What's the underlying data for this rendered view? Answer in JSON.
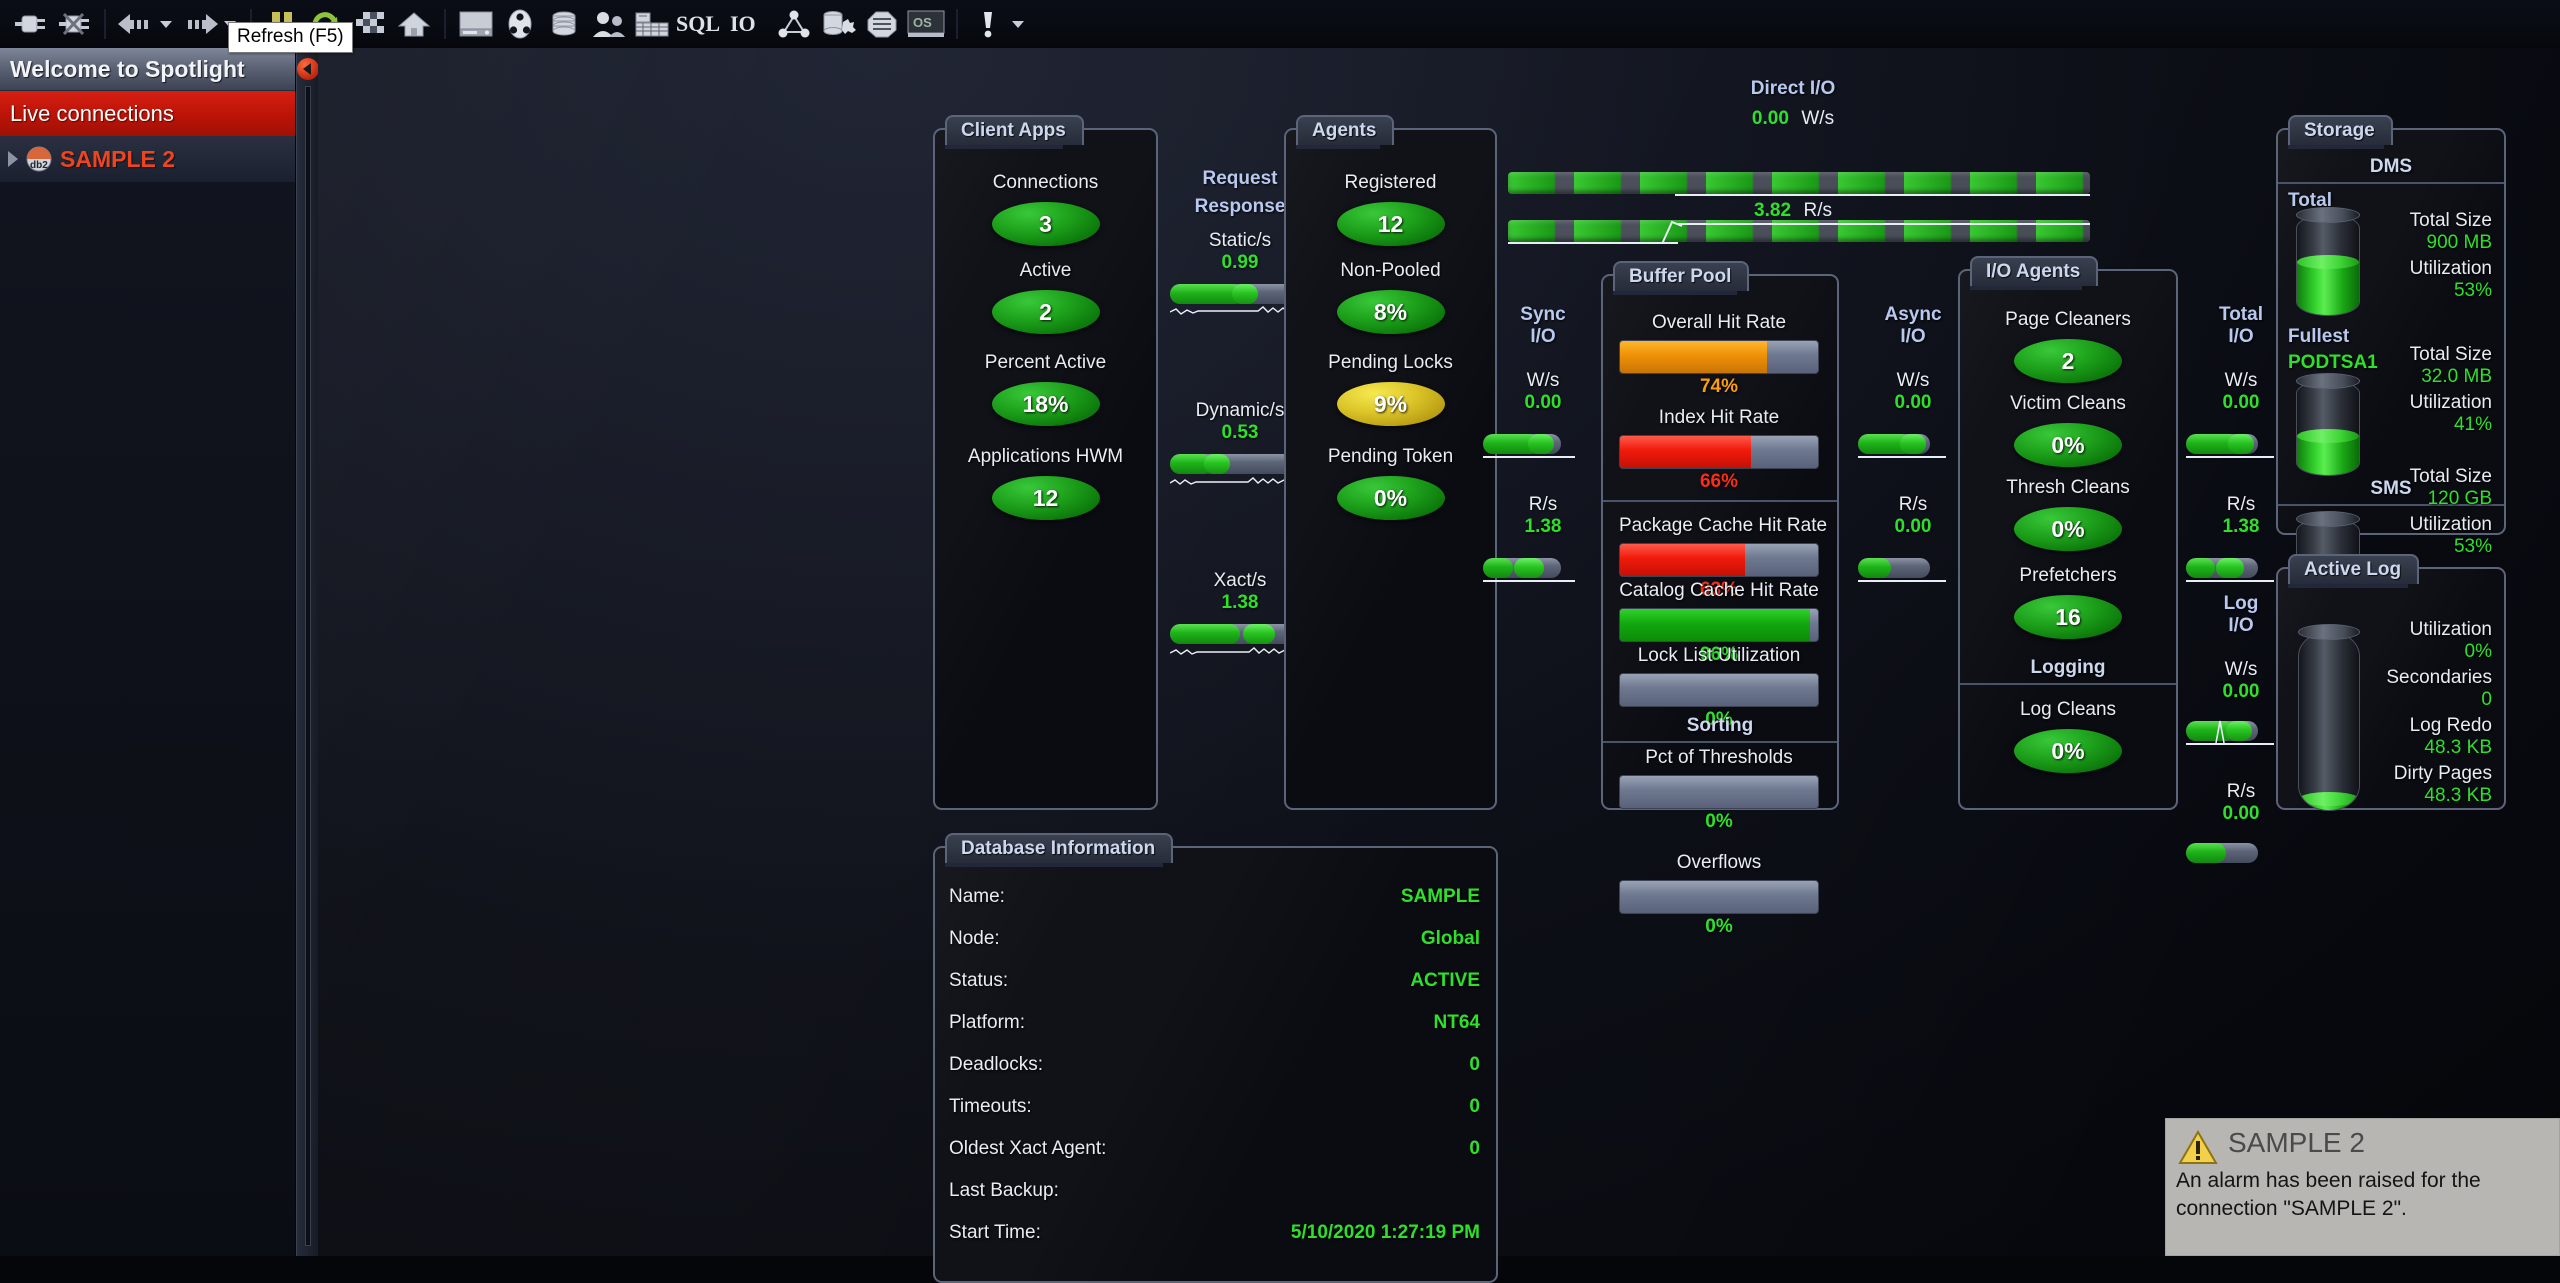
{
  "app": {
    "tooltip": "Refresh (F5)"
  },
  "toolbar": {
    "buttons": [
      {
        "name": "connect-icon",
        "label": "Connect"
      },
      {
        "name": "disconnect-icon",
        "label": "Disconnect"
      },
      {
        "name": "back-icon",
        "label": "Back"
      },
      {
        "name": "back-dropdown-icon",
        "label": "Back history"
      },
      {
        "name": "forward-icon",
        "label": "Forward"
      },
      {
        "name": "forward-dropdown-icon",
        "label": "Forward history"
      },
      {
        "name": "pause-icon",
        "label": "Pause"
      },
      {
        "name": "refresh-icon",
        "label": "Refresh (F5)"
      },
      {
        "name": "playback-icon",
        "label": "Playback"
      },
      {
        "name": "home-icon",
        "label": "Home"
      },
      {
        "name": "server-icon",
        "label": "Server"
      },
      {
        "name": "sessions-icon",
        "label": "Sessions"
      },
      {
        "name": "database-icon",
        "label": "Databases"
      },
      {
        "name": "users-icon",
        "label": "Users"
      },
      {
        "name": "buildings-icon",
        "label": "Tablespaces"
      },
      {
        "name": "sql-icon",
        "label": "SQL"
      },
      {
        "name": "io-icon",
        "label": "IO"
      },
      {
        "name": "topology-icon",
        "label": "Topology"
      },
      {
        "name": "storage-tool-icon",
        "label": "Storage"
      },
      {
        "name": "logs-icon",
        "label": "Logs"
      },
      {
        "name": "os-icon",
        "label": "OS"
      },
      {
        "name": "alarm-icon",
        "label": "Alarms"
      },
      {
        "name": "alarm-dropdown-icon",
        "label": "Alarm options"
      }
    ]
  },
  "sidebar": {
    "title": "Welcome to Spotlight",
    "live_connections_label": "Live connections",
    "connections": [
      {
        "label": "SAMPLE 2",
        "icon": "db2-connection-icon"
      }
    ]
  },
  "client_apps": {
    "title": "Client Apps",
    "metrics": [
      {
        "caption": "Connections",
        "value": "3",
        "color": "green"
      },
      {
        "caption": "Active",
        "value": "2",
        "color": "green"
      },
      {
        "caption": "Percent Active",
        "value": "18%",
        "color": "green"
      },
      {
        "caption": "Applications HWM",
        "value": "12",
        "color": "green"
      }
    ]
  },
  "request_response": {
    "line1": "Request",
    "line2": "Response",
    "gauges": [
      {
        "caption": "Static/s",
        "value": "0.99",
        "fill_pct": 52
      },
      {
        "caption": "Dynamic/s",
        "value": "0.53",
        "fill_pct": 30
      },
      {
        "caption": "Xact/s",
        "value": "1.38",
        "fill_pct": 72
      }
    ]
  },
  "agents": {
    "title": "Agents",
    "metrics": [
      {
        "caption": "Registered",
        "value": "12",
        "color": "green"
      },
      {
        "caption": "Non-Pooled",
        "value": "8%",
        "color": "green"
      },
      {
        "caption": "Pending Locks",
        "value": "9%",
        "color": "yellow"
      },
      {
        "caption": "Pending Token",
        "value": "0%",
        "color": "green"
      }
    ]
  },
  "direct_io": {
    "title": "Direct I/O",
    "write_value": "0.00",
    "write_unit": "W/s",
    "read_value": "3.82",
    "read_unit": "R/s"
  },
  "sync_io": {
    "title_line1": "Sync",
    "title_line2": "I/O",
    "write_unit": "W/s",
    "write_value": "0.00",
    "read_unit": "R/s",
    "read_value": "1.38"
  },
  "async_io": {
    "title_line1": "Async",
    "title_line2": "I/O",
    "write_unit": "W/s",
    "write_value": "0.00",
    "read_unit": "R/s",
    "read_value": "0.00"
  },
  "total_io": {
    "title_line1": "Total",
    "title_line2": "I/O",
    "write_unit": "W/s",
    "write_value": "0.00",
    "read_unit": "R/s",
    "read_value": "1.38"
  },
  "log_io": {
    "title_line1": "Log",
    "title_line2": "I/O",
    "write_unit": "W/s",
    "write_value": "0.00",
    "read_unit": "R/s",
    "read_value": "0.00"
  },
  "buffer_pool": {
    "title": "Buffer Pool",
    "sorting_header": "Sorting",
    "bars": [
      {
        "caption": "Overall Hit Rate",
        "value": "74%",
        "pct": 74,
        "color": "orange"
      },
      {
        "caption": "Index Hit Rate",
        "value": "66%",
        "pct": 66,
        "color": "red"
      },
      {
        "caption": "Package Cache Hit Rate",
        "value": "63%",
        "pct": 63,
        "color": "red"
      },
      {
        "caption": "Catalog Cache Hit Rate",
        "value": "96%",
        "pct": 96,
        "color": "green"
      },
      {
        "caption": "Lock List Utilization",
        "value": "0%",
        "pct": 0,
        "color": "empty"
      }
    ],
    "sorting_bars": [
      {
        "caption": "Pct of Thresholds",
        "value": "0%",
        "pct": 0,
        "color": "empty"
      },
      {
        "caption": "Overflows",
        "value": "0%",
        "pct": 0,
        "color": "empty"
      }
    ]
  },
  "io_agents": {
    "title": "I/O Agents",
    "logging_header": "Logging",
    "metrics": [
      {
        "caption": "Page Cleaners",
        "value": "2",
        "color": "green"
      },
      {
        "caption": "Victim Cleans",
        "value": "0%",
        "color": "green"
      },
      {
        "caption": "Thresh Cleans",
        "value": "0%",
        "color": "green"
      },
      {
        "caption": "Prefetchers",
        "value": "16",
        "color": "green"
      }
    ],
    "logging_metrics": [
      {
        "caption": "Log Cleans",
        "value": "0%",
        "color": "green"
      }
    ]
  },
  "storage": {
    "title": "Storage",
    "dms_header": "DMS",
    "sms_header": "SMS",
    "total_label": "Total",
    "fullest_label": "Fullest",
    "fullest_name": "PODTSA1",
    "total": {
      "size_label": "Total Size",
      "size_value": "900 MB",
      "util_label": "Utilization",
      "util_value": "53%",
      "util_pct": 53
    },
    "fullest": {
      "size_label": "Total Size",
      "size_value": "32.0 MB",
      "util_label": "Utilization",
      "util_value": "41%",
      "util_pct": 41
    },
    "sms": {
      "size_label": "Total Size",
      "size_value": "120 GB",
      "util_label": "Utilization",
      "util_value": "53%",
      "util_pct": 53
    }
  },
  "active_log": {
    "title": "Active Log",
    "util_label": "Utilization",
    "util_value": "0%",
    "util_pct": 4,
    "secondaries_label": "Secondaries",
    "secondaries_value": "0",
    "log_redo_label": "Log Redo",
    "log_redo_value": "48.3 KB",
    "dirty_pages_label": "Dirty Pages",
    "dirty_pages_value": "48.3 KB"
  },
  "database_information": {
    "title": "Database Information",
    "rows": [
      {
        "key": "Name:",
        "value": "SAMPLE"
      },
      {
        "key": "Node:",
        "value": "Global"
      },
      {
        "key": "Status:",
        "value": "ACTIVE"
      },
      {
        "key": "Platform:",
        "value": "NT64"
      },
      {
        "key": "Deadlocks:",
        "value": "0"
      },
      {
        "key": "Timeouts:",
        "value": "0"
      },
      {
        "key": "Oldest Xact Agent:",
        "value": "0"
      },
      {
        "key": "Last Backup:",
        "value": ""
      },
      {
        "key": "Start Time:",
        "value": "5/10/2020 1:27:19 PM"
      }
    ]
  },
  "toast": {
    "title": "SAMPLE 2",
    "message": "An alarm has been raised for the connection \"SAMPLE 2\"."
  },
  "colors": {
    "accent_blue": "#b8c8ee",
    "value_green": "#2ee02a",
    "value_red": "#ff2b17",
    "value_orange": "#ff9e0b",
    "alert_red": "#bb1307",
    "connection_orange": "#f0441f"
  }
}
